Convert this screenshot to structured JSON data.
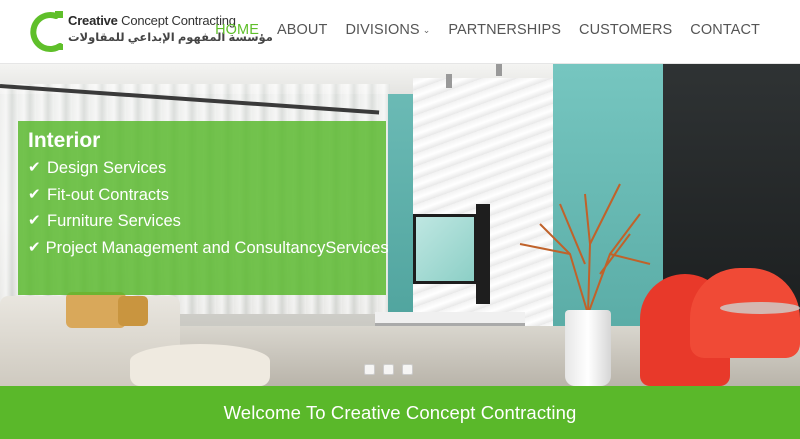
{
  "header": {
    "logo": {
      "name_bold": "Creative",
      "name_rest": " Concept Contracting",
      "name_arabic": "مؤسسة المفهوم الإبداعي للمقاولات",
      "icon": "crescent-c-logo-icon",
      "brand_color": "#5fbf2a"
    },
    "nav": [
      {
        "label": "HOME",
        "active": true
      },
      {
        "label": "ABOUT",
        "active": false
      },
      {
        "label": "DIVISIONS",
        "active": false,
        "icon": "chevron-down-icon"
      },
      {
        "label": "PARTNERSHIPS",
        "active": false
      },
      {
        "label": "CUSTOMERS",
        "active": false
      },
      {
        "label": "CONTACT",
        "active": false
      }
    ]
  },
  "hero": {
    "title": "Interior",
    "check_icon": "check-icon",
    "services": [
      "Design Services",
      "Fit-out Contracts",
      "Furniture Services",
      "Project Management and ConsultancyServices"
    ],
    "slides": 3,
    "overlay_color": "#56b728"
  },
  "welcome": {
    "text": "Welcome To Creative Concept Contracting",
    "background": "#5ab82a"
  }
}
